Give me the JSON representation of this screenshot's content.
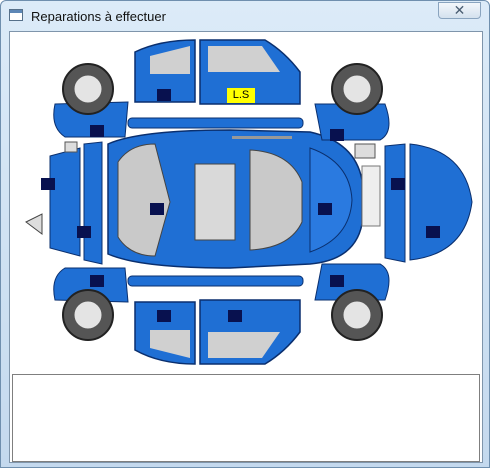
{
  "window": {
    "title": "Reparations à effectuer",
    "close_glyph": "✕"
  },
  "diagram": {
    "label_tag": "L.S"
  },
  "colors": {
    "body_blue": "#1f6fd4",
    "marker": "#08114f",
    "tag_bg": "#ffff00"
  }
}
